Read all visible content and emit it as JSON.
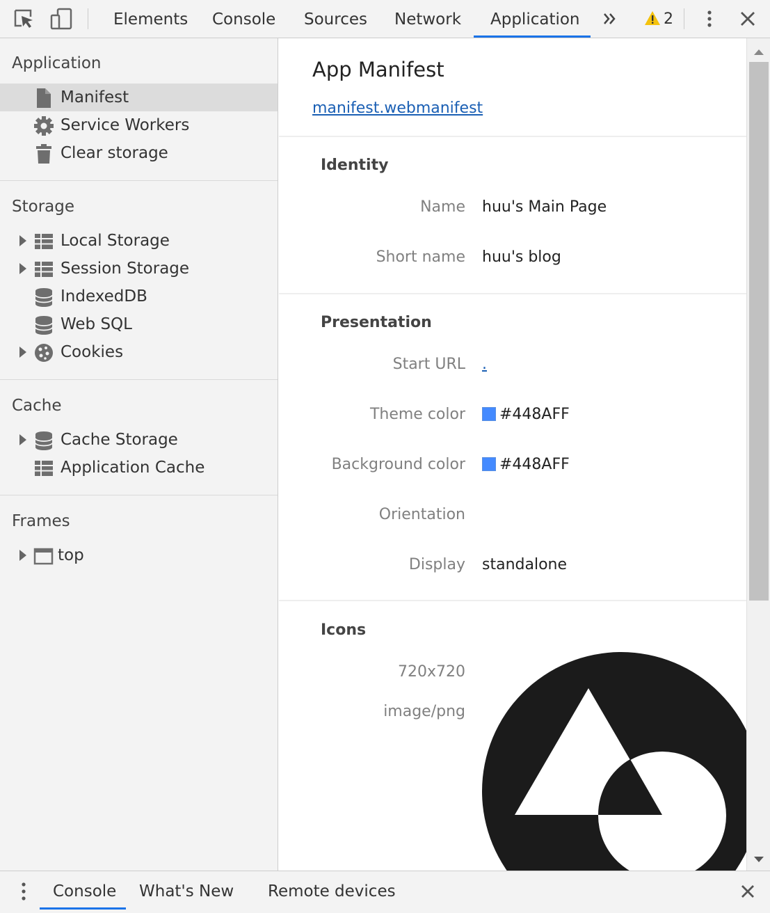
{
  "toolbar": {
    "tabs": [
      {
        "label": "Elements"
      },
      {
        "label": "Console"
      },
      {
        "label": "Sources"
      },
      {
        "label": "Network"
      },
      {
        "label": "Application"
      }
    ],
    "active_tab": "Application",
    "warning_count": "2"
  },
  "sidebar": {
    "application": {
      "title": "Application",
      "items": [
        {
          "label": "Manifest",
          "icon": "file-icon",
          "selected": true
        },
        {
          "label": "Service Workers",
          "icon": "gear-icon"
        },
        {
          "label": "Clear storage",
          "icon": "trash-icon"
        }
      ]
    },
    "storage": {
      "title": "Storage",
      "items": [
        {
          "label": "Local Storage",
          "icon": "grid-icon",
          "expandable": true
        },
        {
          "label": "Session Storage",
          "icon": "grid-icon",
          "expandable": true
        },
        {
          "label": "IndexedDB",
          "icon": "database-icon"
        },
        {
          "label": "Web SQL",
          "icon": "database-icon"
        },
        {
          "label": "Cookies",
          "icon": "cookie-icon",
          "expandable": true
        }
      ]
    },
    "cache": {
      "title": "Cache",
      "items": [
        {
          "label": "Cache Storage",
          "icon": "database-icon",
          "expandable": true
        },
        {
          "label": "Application Cache",
          "icon": "grid-icon"
        }
      ]
    },
    "frames": {
      "title": "Frames",
      "items": [
        {
          "label": "top",
          "icon": "frame-icon",
          "expandable": true
        }
      ]
    }
  },
  "main": {
    "title": "App Manifest",
    "manifest_link": "manifest.webmanifest",
    "identity": {
      "heading": "Identity",
      "name_key": "Name",
      "name_value": "huu's Main Page",
      "short_name_key": "Short name",
      "short_name_value": "huu's blog"
    },
    "presentation": {
      "heading": "Presentation",
      "start_url_key": "Start URL",
      "start_url_value": ".",
      "theme_color_key": "Theme color",
      "theme_color_value": "#448AFF",
      "background_color_key": "Background color",
      "background_color_value": "#448AFF",
      "orientation_key": "Orientation",
      "orientation_value": "",
      "display_key": "Display",
      "display_value": "standalone"
    },
    "icons": {
      "heading": "Icons",
      "size": "720x720",
      "type": "image/png"
    }
  },
  "drawer": {
    "tabs": [
      {
        "label": "Console"
      },
      {
        "label": "What's New"
      },
      {
        "label": "Remote devices"
      }
    ],
    "active_tab": "Console"
  },
  "colors": {
    "accent": "#1a73e8",
    "swatch": "#448AFF",
    "warning": "#f4c20d"
  }
}
